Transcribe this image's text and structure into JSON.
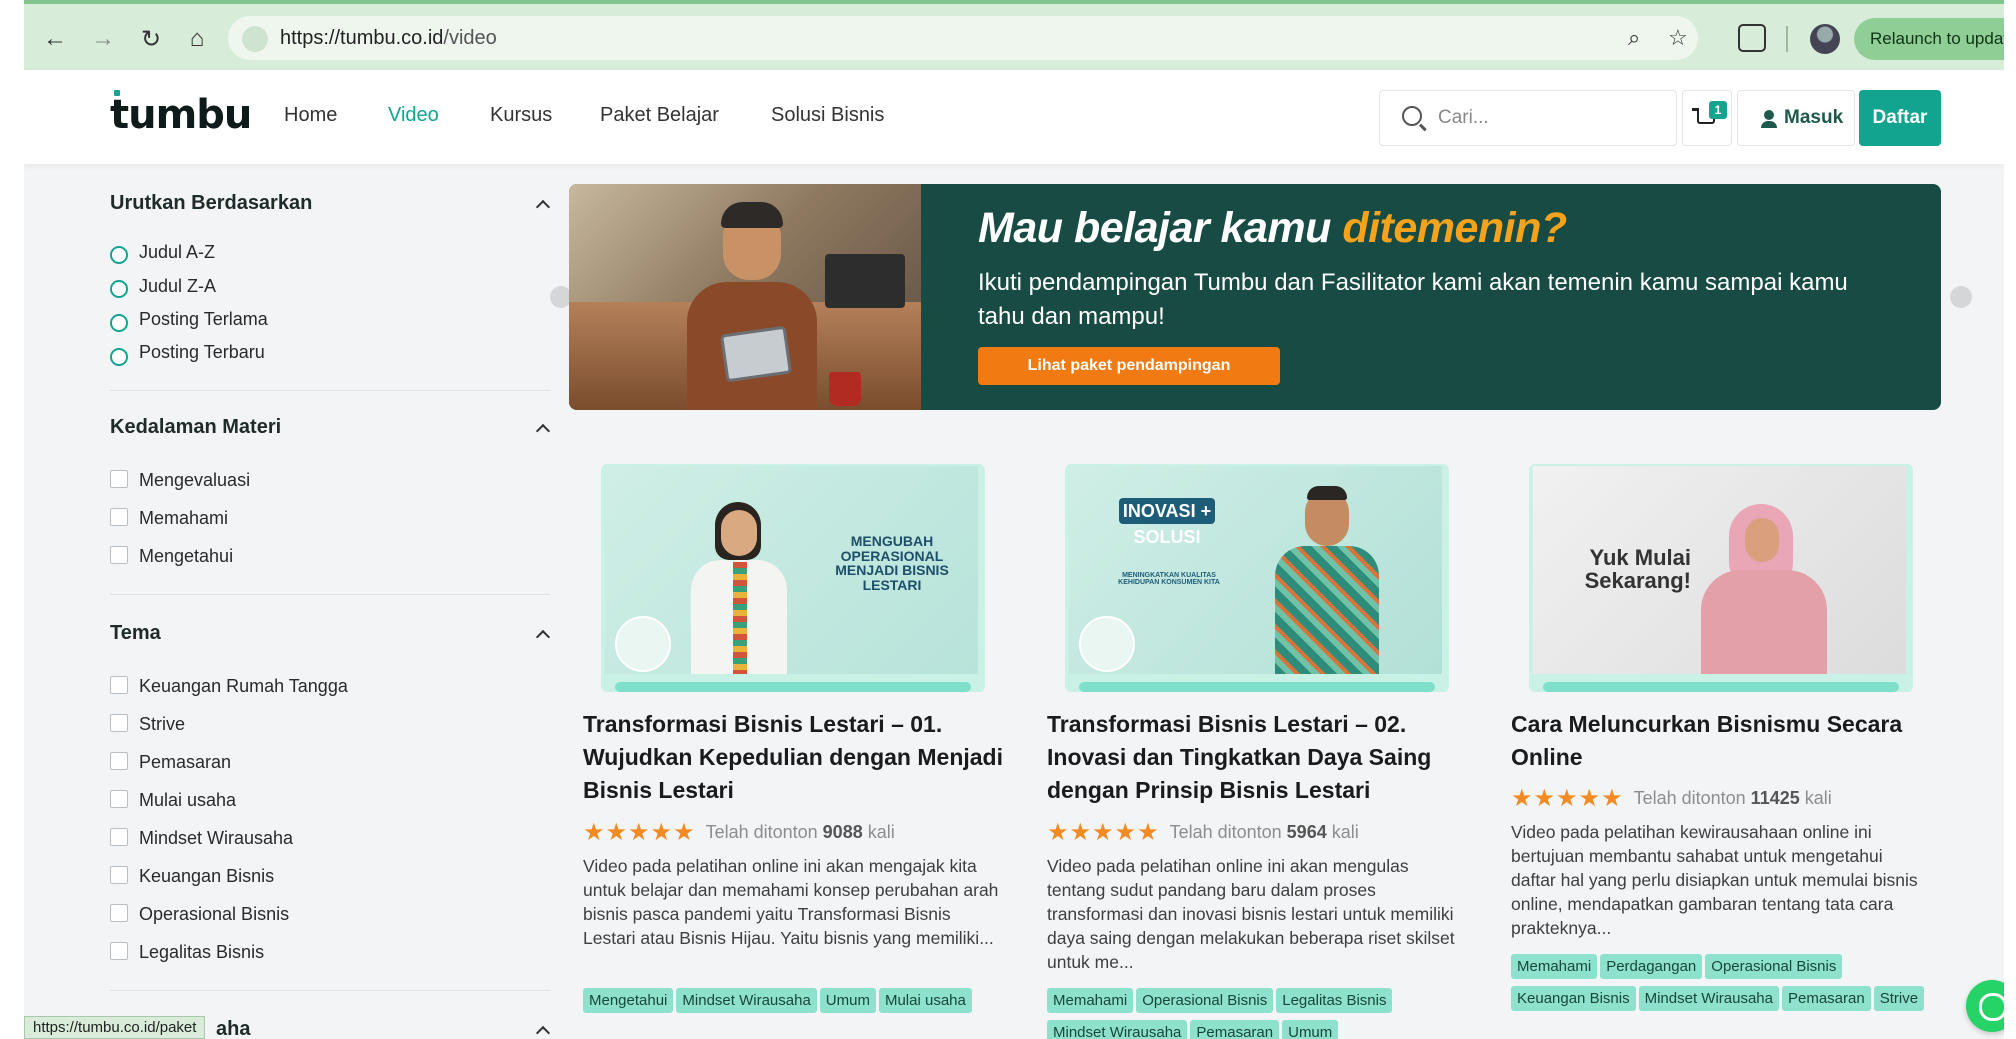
{
  "browser": {
    "url_host": "https://tumbu.co.id",
    "url_path": "/video",
    "relaunch_label": "Relaunch to update"
  },
  "header": {
    "logo": "tumbu",
    "nav": [
      "Home",
      "Video",
      "Kursus",
      "Paket Belajar",
      "Solusi Bisnis"
    ],
    "active_nav": "Video",
    "search_placeholder": "Cari...",
    "cart_count": "1",
    "login_label": "Masuk",
    "register_label": "Daftar"
  },
  "sidebar": {
    "sort": {
      "title": "Urutkan Berdasarkan",
      "options": [
        "Judul A-Z",
        "Judul Z-A",
        "Posting Terlama",
        "Posting Terbaru"
      ]
    },
    "depth": {
      "title": "Kedalaman Materi",
      "options": [
        "Mengevaluasi",
        "Memahami",
        "Mengetahui"
      ]
    },
    "theme": {
      "title": "Tema",
      "options": [
        "Keuangan Rumah Tangga",
        "Strive",
        "Pemasaran",
        "Mulai usaha",
        "Mindset Wirausaha",
        "Keuangan Bisnis",
        "Operasional Bisnis",
        "Legalitas Bisnis"
      ]
    },
    "next_title_partial": "aha"
  },
  "banner": {
    "headline_main": "Mau belajar kamu ",
    "headline_accent": "ditemenin?",
    "subtitle": "Ikuti pendampingan Tumbu dan Fasilitator kami akan temenin kamu sampai kamu tahu dan mampu!",
    "cta": "Lihat paket pendampingan"
  },
  "cards": [
    {
      "thumb_text": "MENGUBAH OPERASIONAL MENJADI BISNIS LESTARI",
      "title": "Transformasi Bisnis Lestari – 01. Wujudkan Kepedulian dengan Menjadi Bisnis Lestari",
      "stars": "★★★★★",
      "views_prefix": "Telah ditonton ",
      "views": "9088",
      "views_suffix": " kali",
      "desc": "Video pada pelatihan online ini akan mengajak kita untuk belajar dan memahami konsep perubahan arah bisnis pasca pandemi yaitu Transformasi Bisnis Lestari atau Bisnis Hijau. Yaitu bisnis yang memiliki...",
      "tags": [
        "Mengetahui",
        "Mindset Wirausaha",
        "Umum",
        "Mulai usaha"
      ]
    },
    {
      "thumb_text": "INOVASI + SOLUSI",
      "thumb_small": "MENINGKATKAN KUALITAS KEHIDUPAN KONSUMEN KITA",
      "title": "Transformasi Bisnis Lestari – 02. Inovasi dan Tingkatkan Daya Saing dengan Prinsip Bisnis Lestari",
      "stars": "★★★★★",
      "views_prefix": "Telah ditonton ",
      "views": "5964",
      "views_suffix": " kali",
      "desc": "Video pada pelatihan online ini akan mengulas tentang sudut pandang baru dalam proses transformasi dan inovasi bisnis lestari untuk memiliki daya saing dengan melakukan beberapa riset skilset untuk me...",
      "tags": [
        "Memahami",
        "Operasional Bisnis",
        "Legalitas Bisnis",
        "Mindset Wirausaha",
        "Pemasaran",
        "Umum"
      ]
    },
    {
      "thumb_text": "Yuk Mulai Sekarang!",
      "title": "Cara Meluncurkan Bisnismu Secara Online",
      "stars": "★★★★★",
      "views_prefix": "Telah ditonton ",
      "views": "11425",
      "views_suffix": " kali",
      "desc": "Video pada pelatihan kewirausahaan online ini bertujuan membantu sahabat untuk mengetahui daftar hal yang perlu disiapkan untuk memulai bisnis online, mendapatkan gambaran tentang tata cara prakteknya...",
      "tags": [
        "Memahami",
        "Perdagangan",
        "Operasional Bisnis",
        "Keuangan Bisnis",
        "Mindset Wirausaha",
        "Pemasaran",
        "Strive"
      ]
    }
  ],
  "status_url": "https://tumbu.co.id/paket"
}
